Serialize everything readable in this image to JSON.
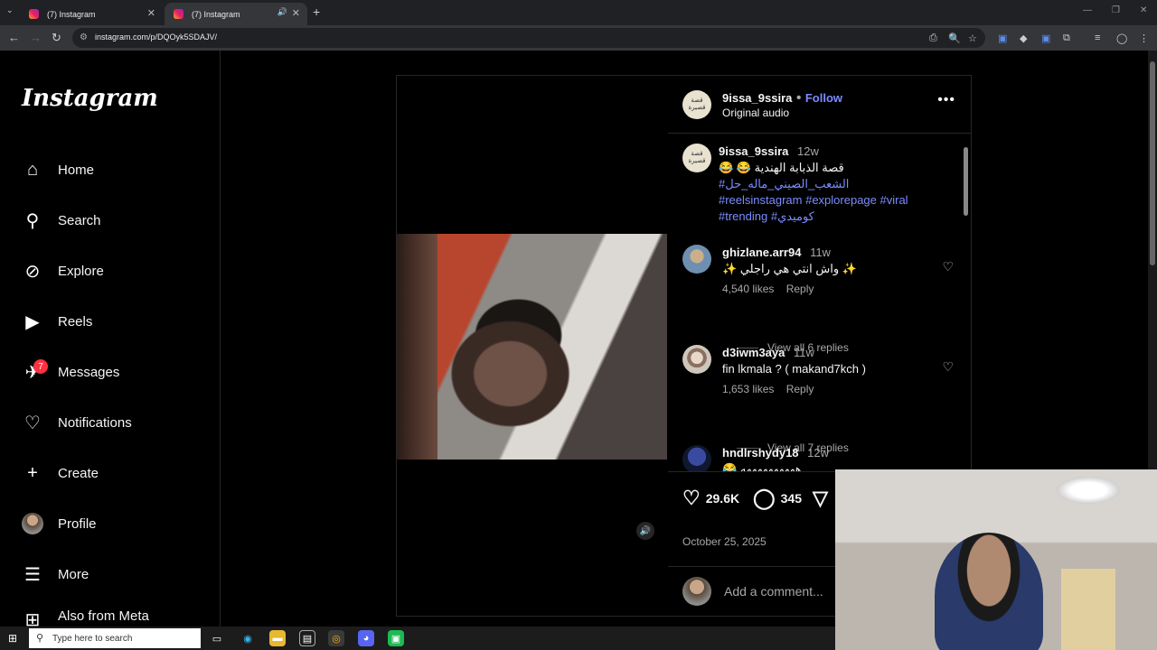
{
  "browser": {
    "tabs": [
      {
        "title": "(7) Instagram"
      },
      {
        "title": "(7) Instagram"
      }
    ],
    "url": "instagram.com/p/DQOyk5SDAJV/"
  },
  "sidebar": {
    "logo": "Instagram",
    "items": [
      {
        "label": "Home",
        "icon": "home-icon"
      },
      {
        "label": "Search",
        "icon": "search-icon"
      },
      {
        "label": "Explore",
        "icon": "compass-icon"
      },
      {
        "label": "Reels",
        "icon": "reels-icon"
      },
      {
        "label": "Messages",
        "icon": "messenger-icon",
        "badge": "7"
      },
      {
        "label": "Notifications",
        "icon": "heart-icon"
      },
      {
        "label": "Create",
        "icon": "plus-icon"
      },
      {
        "label": "Profile",
        "icon": "avatar"
      },
      {
        "label": "More",
        "icon": "menu-icon"
      },
      {
        "label": "Also from Meta",
        "icon": "meta-icon"
      }
    ]
  },
  "post": {
    "author": "9issa_9ssira",
    "avatar_text": "قصة قصيرة",
    "follow_label": "Follow",
    "audio": "Original audio",
    "caption": {
      "user": "9issa_9ssira",
      "time": "12w",
      "text": "قصة الذبابة الهندية 😂 😂",
      "tags_line1": "#الشعب_الصيني_ماله_حل",
      "tags_line2": "#reelsinstagram #explorepage #viral",
      "tags_line3": "#trending #كوميدي"
    },
    "comments": [
      {
        "user": "ghizlane.arr94",
        "time": "11w",
        "text": "✨ واش انتي هي راجلي ✨",
        "likes": "4,540 likes",
        "reply": "Reply",
        "replies": "View all 6 replies"
      },
      {
        "user": "d3iwm3aya",
        "time": "11w",
        "text": "fin lkmala ? ( makand7kch )",
        "likes": "1,653 likes",
        "reply": "Reply",
        "replies": "View all 7 replies"
      },
      {
        "user": "hndlrshydy18",
        "time": "12w",
        "text": "😂 ههههههههههه"
      }
    ],
    "likes_count": "29.6K",
    "comments_count": "345",
    "date": "October 25, 2025",
    "add_comment_placeholder": "Add a comment..."
  },
  "taskbar": {
    "search_placeholder": "Type here to search"
  }
}
